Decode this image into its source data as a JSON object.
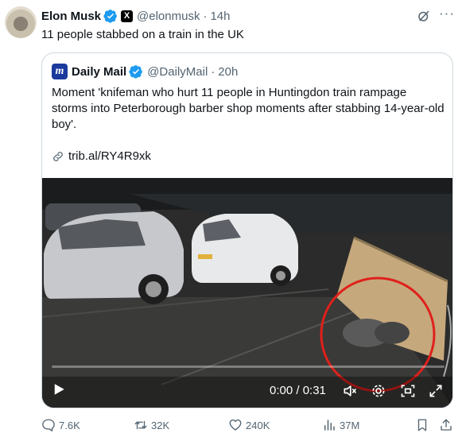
{
  "tweet": {
    "author_name": "Elon Musk",
    "handle": "@elonmusk",
    "separator": "·",
    "time": "14h",
    "affiliate_badge": "X",
    "text": "11 people stabbed on a train in the UK"
  },
  "quote": {
    "author_name": "Daily Mail",
    "logo_letter": "m",
    "handle": "@DailyMail",
    "separator": "·",
    "time": "20h",
    "text": "Moment 'knifeman who hurt 11 people in Huntingdon train rampage storms into Peterborough barber shop moments after stabbing 14-year-old boy'.",
    "link": "trib.al/RY4R9xk",
    "video": {
      "time_display": "0:00 / 0:31",
      "progress": 0.0
    }
  },
  "actions": {
    "replies": "7.6K",
    "reposts": "32K",
    "likes": "240K",
    "views": "37M"
  },
  "colors": {
    "verified_blue": "#1d9bf0",
    "text": "#0f1419",
    "secondary": "#536471",
    "border": "#cfd9de",
    "annotation_red": "#e0201b"
  },
  "icons": [
    "verified-icon",
    "grok-icon",
    "more-icon",
    "link-icon",
    "play-icon",
    "mute-icon",
    "settings-icon",
    "pip-icon",
    "fullscreen-icon",
    "reply-icon",
    "repost-icon",
    "like-icon",
    "views-icon",
    "bookmark-icon",
    "share-icon"
  ]
}
